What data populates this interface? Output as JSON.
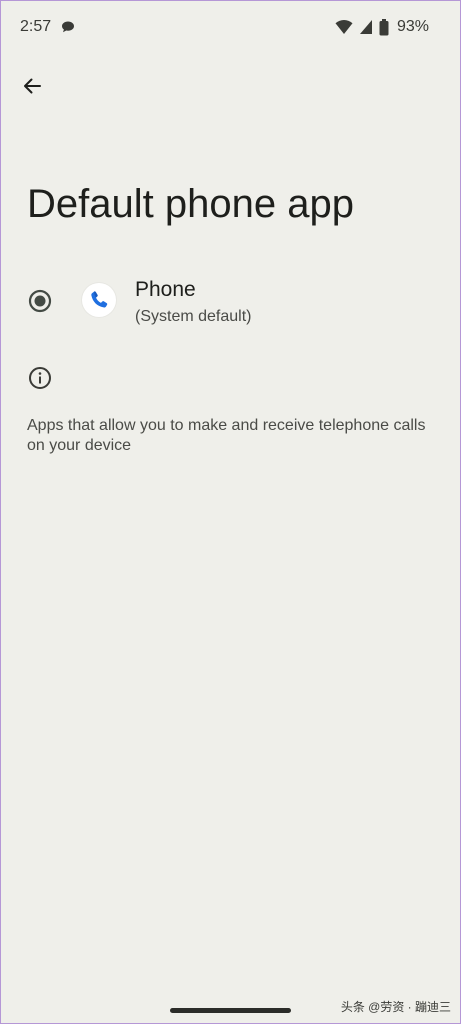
{
  "status_bar": {
    "time": "2:57",
    "battery": "93%",
    "icons": [
      "chat-bubble-icon",
      "wifi-icon",
      "cell-signal-icon",
      "battery-icon"
    ]
  },
  "header": {
    "back_icon": "arrow-left-icon"
  },
  "page": {
    "title": "Default phone app"
  },
  "apps": [
    {
      "name": "Phone",
      "subtitle": "(System default)",
      "selected": true,
      "icon": "phone-app-icon"
    }
  ],
  "info": {
    "icon": "info-icon",
    "text": "Apps that allow you to make and receive telephone calls on your device"
  },
  "watermark": "头条 @劳资 · 蹦迪三",
  "colors": {
    "background": "#efefea",
    "radio": "#444b45",
    "phone_blue": "#1f6fe0"
  }
}
